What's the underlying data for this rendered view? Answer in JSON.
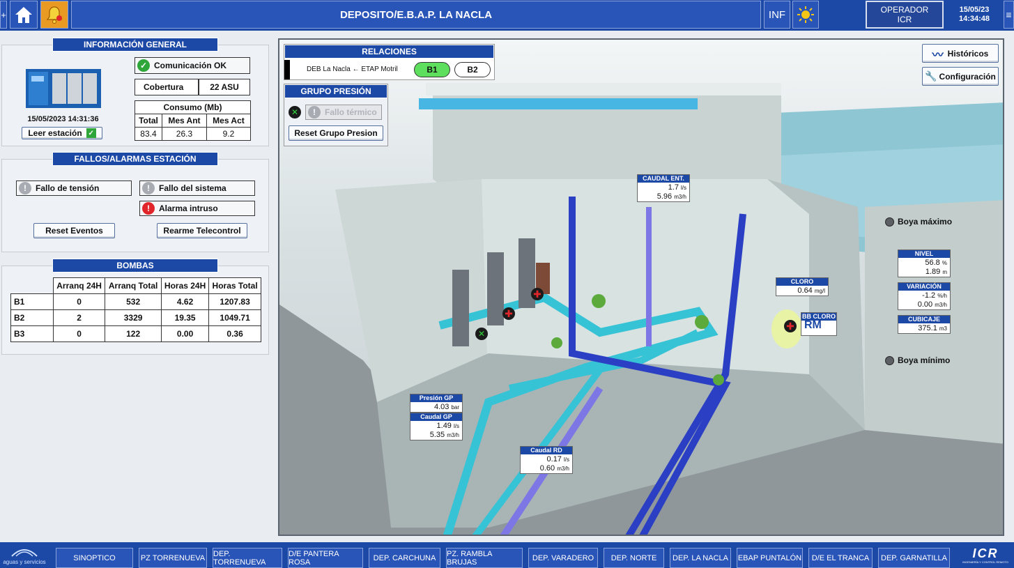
{
  "header": {
    "title": "DEPOSITO/E.B.A.P. LA NACLA",
    "inf": "INF",
    "plus": "+",
    "menu": "≡",
    "operator_line1": "OPERADOR",
    "operator_line2": "ICR",
    "date": "15/05/23",
    "time": "14:34:48"
  },
  "info": {
    "title": "INFORMACIÓN GENERAL",
    "timestamp": "15/05/2023 14:31:36",
    "read_btn": "Leer estación",
    "comm": "Comunicación OK",
    "coverage_label": "Cobertura",
    "coverage_value": "22 ASU",
    "consumo_title": "Consumo (Mb)",
    "cols": [
      "Total",
      "Mes Ant",
      "Mes Act"
    ],
    "vals": [
      "83.4",
      "26.3",
      "9.2"
    ]
  },
  "alarms": {
    "title": "FALLOS/ALARMAS ESTACIÓN",
    "fallo_tension": "Fallo de tensión",
    "fallo_sistema": "Fallo del sistema",
    "alarma_intruso": "Alarma intruso",
    "reset_eventos": "Reset Eventos",
    "rearme": "Rearme Telecontrol"
  },
  "bombas": {
    "title": "BOMBAS",
    "cols": [
      "Arranq 24H",
      "Arranq Total",
      "Horas 24H",
      "Horas Total"
    ],
    "rows": [
      {
        "name": "B1",
        "v": [
          "0",
          "532",
          "4.62",
          "1207.83"
        ]
      },
      {
        "name": "B2",
        "v": [
          "2",
          "3329",
          "19.35",
          "1049.71"
        ]
      },
      {
        "name": "B3",
        "v": [
          "0",
          "122",
          "0.00",
          "0.36"
        ]
      }
    ]
  },
  "relaciones": {
    "title": "RELACIONES",
    "text": "DEB La Nacla ← ETAP Motril",
    "b1": "B1",
    "b2": "B2"
  },
  "grupo": {
    "title": "GRUPO PRESIÓN",
    "fallo": "Fallo térmico",
    "reset": "Reset Grupo Presion"
  },
  "tools": {
    "historicos": "Históricos",
    "config": "Configuración"
  },
  "tags": {
    "caudal_ent": {
      "title": "CAUDAL ENT.",
      "v1": "1.7",
      "u1": "l/s",
      "v2": "5.96",
      "u2": "m3/h"
    },
    "cloro": {
      "title": "CLORO",
      "v1": "0.64",
      "u1": "mg/l"
    },
    "bb_cloro": {
      "title": "BB CLORO",
      "v1": "RM"
    },
    "presion_gp": {
      "title": "Presión GP",
      "v1": "4.03",
      "u1": "bar"
    },
    "caudal_gp": {
      "title": "Caudal GP",
      "v1": "1.49",
      "u1": "l/s",
      "v2": "5.35",
      "u2": "m3/h"
    },
    "caudal_rd": {
      "title": "Caudal RD",
      "v1": "0.17",
      "u1": "l/s",
      "v2": "0.60",
      "u2": "m3/h"
    },
    "nivel": {
      "title": "NIVEL",
      "v1": "56.8",
      "u1": "%",
      "v2": "1.89",
      "u2": "m"
    },
    "variacion": {
      "title": "VARIACIÓN",
      "v1": "-1.2",
      "u1": "%/h",
      "v2": "0.00",
      "u2": "m3/h"
    },
    "cubicaje": {
      "title": "CUBICAJE",
      "v1": "375.1",
      "u1": "m3"
    }
  },
  "boya_max": "Boya máximo",
  "boya_min": "Boya mínimo",
  "nav": [
    "SINOPTICO",
    "PZ TORRENUEVA",
    "DEP. TORRENUEVA",
    "D/E PANTERA ROSA",
    "DEP. CARCHUNA",
    "PZ. RAMBLA BRUJAS",
    "DEP. VARADERO",
    "DEP. NORTE",
    "DEP. LA NACLA",
    "EBAP  PUNTALÓN",
    "D/E EL TRANCA",
    "DEP. GARNATILLA"
  ],
  "logo_text": "aguas y servicios",
  "logo_right": "ICR",
  "logo_right_sub": "INGENIERÍA Y CONTROL REMOTO",
  "colors": {
    "brand": "#1d49a6",
    "ok": "#2fa63a",
    "alarm": "#e0262b",
    "pipe_cyan": "#37c3d6",
    "pipe_blue": "#2a3fc4"
  }
}
